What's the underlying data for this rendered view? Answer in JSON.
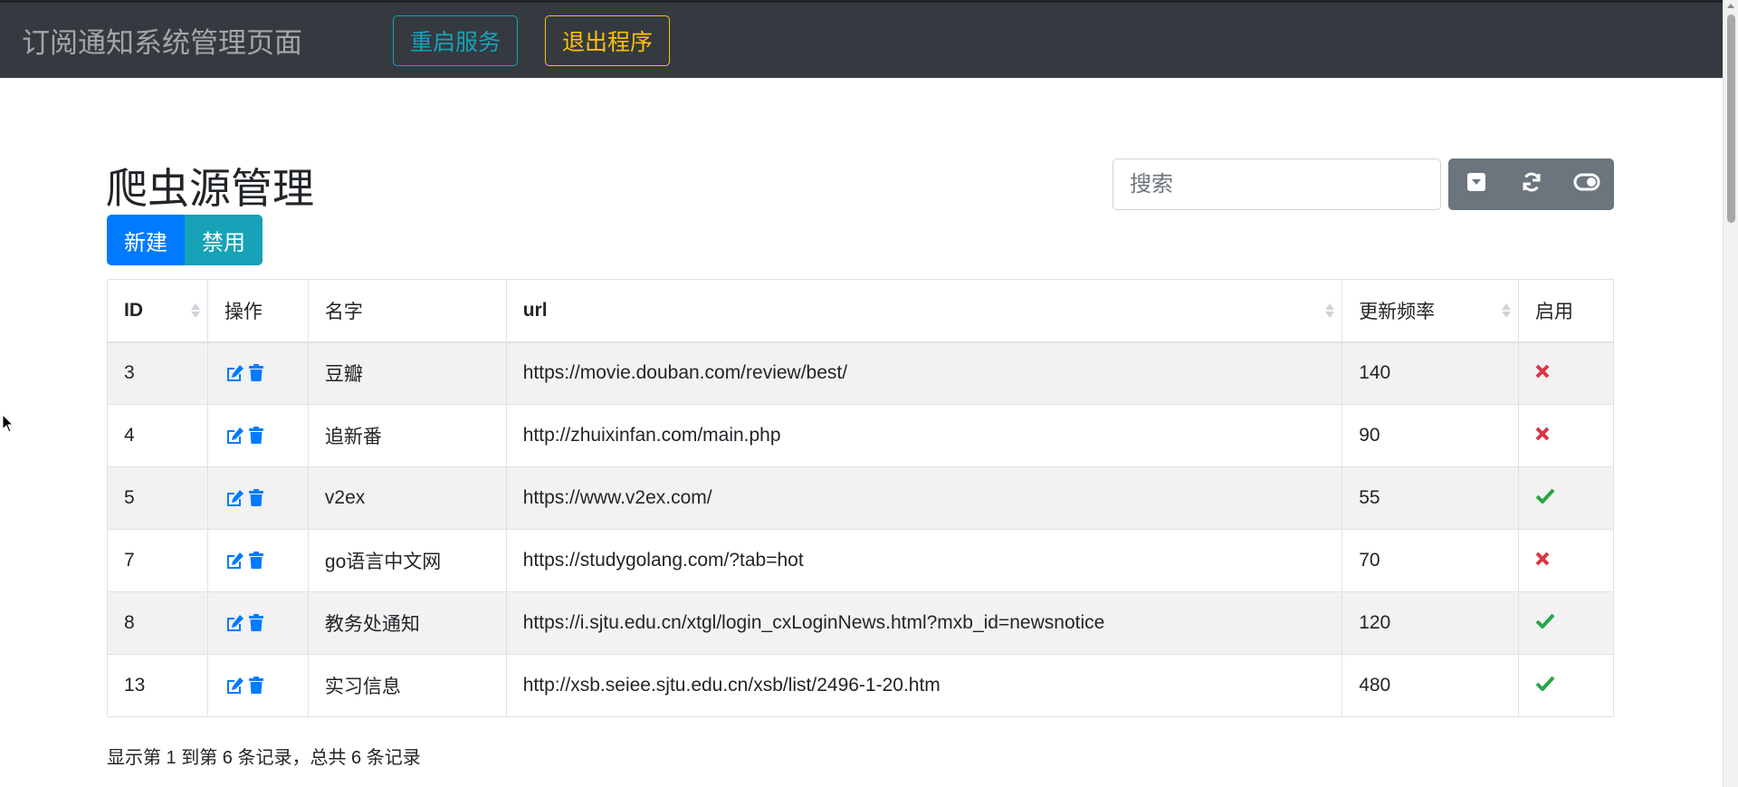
{
  "navbar": {
    "brand": "订阅通知系统管理页面",
    "restart_label": "重启服务",
    "exit_label": "退出程序"
  },
  "page": {
    "title": "爬虫源管理",
    "new_label": "新建",
    "disable_label": "禁用"
  },
  "search": {
    "placeholder": "搜索",
    "value": ""
  },
  "toolbar": {
    "icons": [
      "dropdown-toggle-icon",
      "refresh-icon",
      "toggle-view-icon"
    ]
  },
  "table": {
    "headers": {
      "id": "ID",
      "ops": "操作",
      "name": "名字",
      "url": "url",
      "freq": "更新频率",
      "enabled": "启用"
    },
    "rows": [
      {
        "id": "3",
        "name": "豆瓣",
        "url": "https://movie.douban.com/review/best/",
        "freq": "140",
        "enabled": false
      },
      {
        "id": "4",
        "name": "追新番",
        "url": "http://zhuixinfan.com/main.php",
        "freq": "90",
        "enabled": false
      },
      {
        "id": "5",
        "name": "v2ex",
        "url": "https://www.v2ex.com/",
        "freq": "55",
        "enabled": true
      },
      {
        "id": "7",
        "name": "go语言中文网",
        "url": "https://studygolang.com/?tab=hot",
        "freq": "70",
        "enabled": false
      },
      {
        "id": "8",
        "name": "教务处通知",
        "url": "https://i.sjtu.edu.cn/xtgl/login_cxLoginNews.html?mxb_id=newsnotice",
        "freq": "120",
        "enabled": true
      },
      {
        "id": "13",
        "name": "实习信息",
        "url": "http://xsb.seiee.sjtu.edu.cn/xsb/list/2496-1-20.htm",
        "freq": "480",
        "enabled": true
      }
    ]
  },
  "pagination": {
    "summary": "显示第 1 到第 6 条记录，总共 6 条记录"
  },
  "colors": {
    "navbar_bg": "#343a40",
    "primary": "#007bff",
    "info": "#17a2b8",
    "warning": "#ffc107",
    "secondary": "#6c757d",
    "enabled_check": "#28a745",
    "disabled_cross": "#dc3545"
  }
}
